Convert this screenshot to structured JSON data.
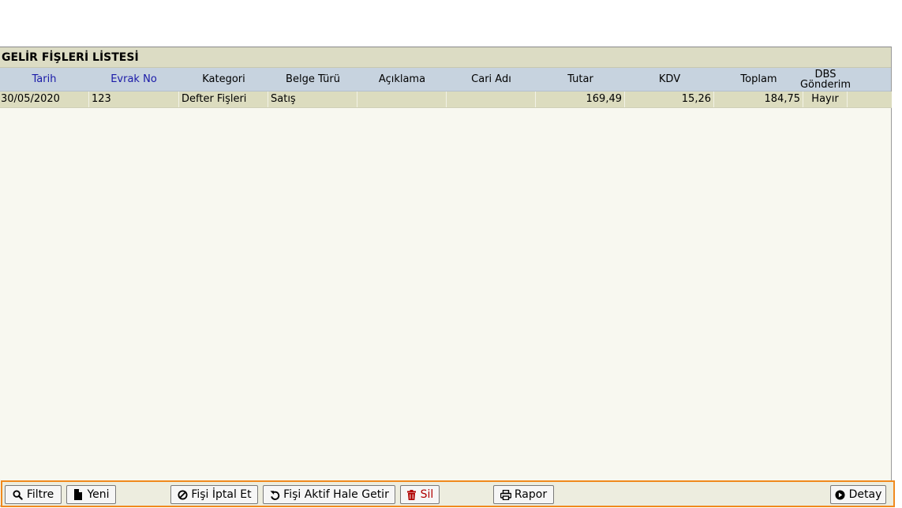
{
  "panel": {
    "title": "GELİR FİŞLERİ LİSTESİ"
  },
  "table": {
    "columns": [
      "Tarih",
      "Evrak No",
      "Kategori",
      "Belge Türü",
      "Açıklama",
      "Cari Adı",
      "Tutar",
      "KDV",
      "Toplam",
      "DBS Gönderim"
    ],
    "dbs_line1": "DBS",
    "dbs_line2": "Gönderim",
    "rows": [
      [
        "30/05/2020",
        "123",
        "Defter Fişleri",
        "Satış",
        "",
        "",
        "169,49",
        "15,26",
        "184,75",
        "Hayır"
      ]
    ]
  },
  "toolbar": {
    "filter_label": "Filtre",
    "new_label": "Yeni",
    "cancel_label": "Fişi İptal Et",
    "activate_label": "Fişi Aktif Hale Getir",
    "delete_label": "Sil",
    "report_label": "Rapor",
    "detail_label": "Detay"
  },
  "colors": {
    "title_bg": "#dcdcc4",
    "header_bg": "#c7d3df",
    "sortable_header": "#1a1aa8",
    "row_bg": "#dcdcbf",
    "toolbar_border": "#f08a1e",
    "danger": "#b00000"
  },
  "icons": [
    "search-icon",
    "file-icon",
    "ban-icon",
    "undo-icon",
    "trash-icon",
    "print-icon",
    "play-circle-icon"
  ]
}
